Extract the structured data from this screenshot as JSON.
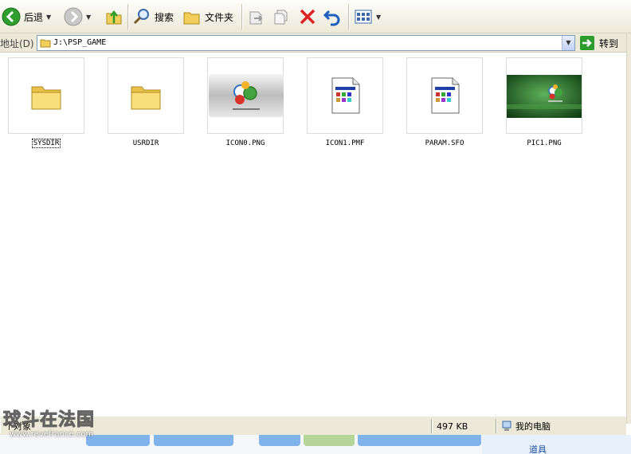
{
  "toolbar": {
    "back_label": "后退",
    "search_label": "搜索",
    "folders_label": "文件夹",
    "go_label": "转到"
  },
  "address": {
    "label": "地址(D)",
    "path": "J:\\PSP_GAME"
  },
  "files": [
    {
      "name": "SYSDIR",
      "type": "folder"
    },
    {
      "name": "USRDIR",
      "type": "folder"
    },
    {
      "name": "ICON0.PNG",
      "type": "image-logo"
    },
    {
      "name": "ICON1.PMF",
      "type": "generic-file"
    },
    {
      "name": "PARAM.SFO",
      "type": "generic-file"
    },
    {
      "name": "PIC1.PNG",
      "type": "image-field"
    }
  ],
  "status": {
    "objects_text": "个对象",
    "size_text": "497 KB",
    "location_text": "我的电脑"
  },
  "watermark": {
    "title": "球斗在法国",
    "url": "www.revefrance.com"
  },
  "background": {
    "side_text": "道具"
  },
  "colors": {
    "toolbar_bg": "#ece9d8",
    "folder": "#f5d76e",
    "green_go": "#2d9b2d",
    "delete_red": "#d22"
  }
}
